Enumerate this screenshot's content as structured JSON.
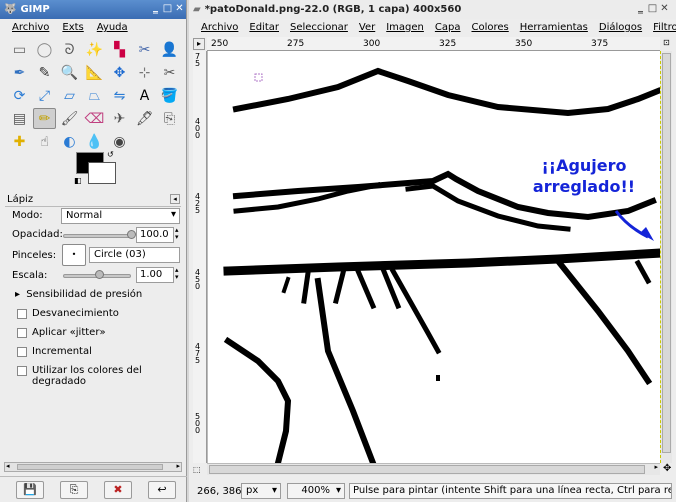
{
  "toolbox": {
    "title": "GIMP",
    "menu": [
      "Archivo",
      "Exts",
      "Ayuda"
    ],
    "tools": [
      "rect-select",
      "ellipse-select",
      "lasso",
      "fuzzy-select",
      "color-select",
      "scissors",
      "foreground-select",
      "paths",
      "color-picker",
      "zoom",
      "measure",
      "move",
      "align",
      "crop",
      "rotate",
      "scale",
      "shear",
      "perspective",
      "flip",
      "text",
      "bucket-fill",
      "blend",
      "pencil",
      "paintbrush",
      "eraser",
      "airbrush",
      "ink",
      "clone",
      "heal",
      "smudge",
      "dodge-burn",
      "convolve",
      "color-tool"
    ],
    "active_tool_index": 22,
    "colors": {
      "foreground": "#000000",
      "background": "#ffffff"
    },
    "options": {
      "title": "Lápiz",
      "mode_label": "Modo:",
      "mode_value": "Normal",
      "opacity_label": "Opacidad:",
      "opacity_value": "100.0",
      "opacity_level": 1.0,
      "brushes_label": "Pinceles:",
      "brush_value": "Circle (03)",
      "scale_label": "Escala:",
      "scale_value": "1.00",
      "scale_level": 0.5,
      "pressure_label": "Sensibilidad de presión",
      "checks": [
        {
          "label": "Desvanecimiento",
          "checked": false
        },
        {
          "label": "Aplicar «jitter»",
          "checked": false
        },
        {
          "label": "Incremental",
          "checked": false
        },
        {
          "label": "Utilizar los colores del degradado",
          "checked": false
        }
      ]
    }
  },
  "image_window": {
    "title": "*patoDonald.png-22.0 (RGB, 1 capa) 400x560",
    "menu": [
      "Archivo",
      "Editar",
      "Seleccionar",
      "Ver",
      "Imagen",
      "Capa",
      "Colores",
      "Herramientas",
      "Diálogos",
      "Filtros"
    ],
    "ruler_h": [
      "250",
      "275",
      "300",
      "325",
      "350",
      "375"
    ],
    "ruler_v": [
      "75",
      "400",
      "425",
      "450",
      "475",
      "500"
    ],
    "annotation": [
      "¡¡Agujero",
      "arreglado!!"
    ],
    "annotation_color": "#1424d8",
    "status": {
      "coords": "266, 386",
      "unit": "px",
      "zoom": "400%",
      "message": "Pulse para pintar (intente Shift para una línea recta, Ctrl para reco..."
    }
  }
}
